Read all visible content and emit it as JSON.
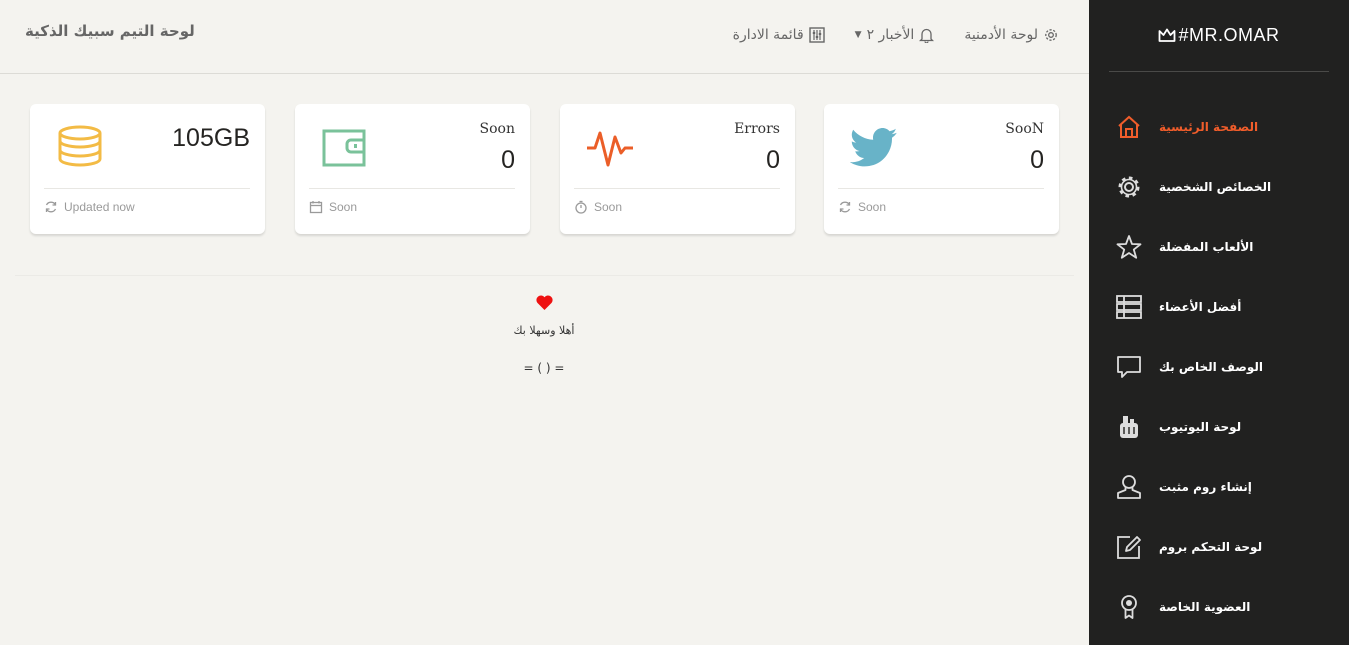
{
  "header": {
    "title": "لوحة التيم سبيك الذكية",
    "links": [
      {
        "label": "قائمة الادارة"
      },
      {
        "label": "الأخبار ٢"
      },
      {
        "label": "لوحة الأدمنية"
      }
    ]
  },
  "cards": [
    {
      "value": "105GB",
      "category": "",
      "footer": "Updated now",
      "icon_color": "#f3bb45"
    },
    {
      "value": "0",
      "category": "Soon",
      "footer": "Soon",
      "icon_color": "#7ac29a"
    },
    {
      "value": "0",
      "category": "Errors",
      "footer": "Soon",
      "icon_color": "#eb5e28"
    },
    {
      "value": "0",
      "category": "SooN",
      "footer": "Soon",
      "icon_color": "#68b3c8"
    }
  ],
  "welcome": {
    "message": "أهلا وسهلا بك",
    "face": "= ( ) ="
  },
  "sidebar": {
    "brand": "#MR.OMAR",
    "accent": "#f05d2b",
    "items": [
      {
        "label": "الصفحة الرئيسية",
        "icon": "home-icon"
      },
      {
        "label": "الخصائص الشخصية",
        "icon": "gear-icon"
      },
      {
        "label": "الألعاب المفضلة",
        "icon": "star-icon"
      },
      {
        "label": "أفضل الأعضاء",
        "icon": "list-icon"
      },
      {
        "label": "الوصف الخاص بك",
        "icon": "chat-icon"
      },
      {
        "label": "لوحة اليوتيوب",
        "icon": "robot-icon"
      },
      {
        "label": "إنشاء روم مثبت",
        "icon": "user-icon"
      },
      {
        "label": "لوحة التحكم بروم",
        "icon": "edit-icon"
      },
      {
        "label": "العضوية الخاصة",
        "icon": "badge-icon"
      }
    ]
  }
}
